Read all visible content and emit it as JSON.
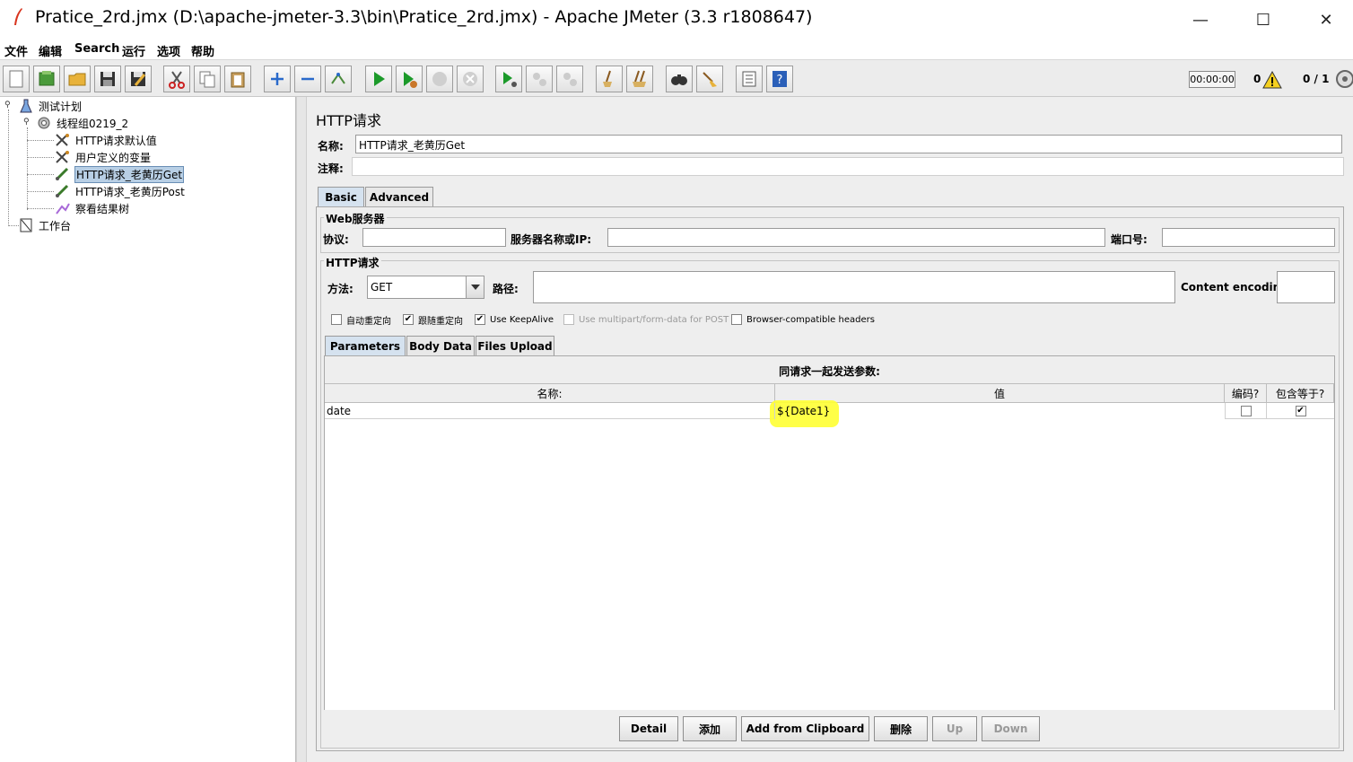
{
  "window": {
    "title": "Pratice_2rd.jmx (D:\\apache-jmeter-3.3\\bin\\Pratice_2rd.jmx) - Apache JMeter (3.3 r1808647)",
    "minimize": "—",
    "maximize": "☐",
    "close": "✕"
  },
  "menu": [
    "文件",
    "编辑",
    "Search",
    "运行",
    "选项",
    "帮助"
  ],
  "toolbar": {
    "timer": "00:00:00",
    "error_count": "0",
    "threads": "0 / 1",
    "icons": [
      "new-icon",
      "templates-icon",
      "open-icon",
      "save-icon",
      "save-as-icon",
      "cut-icon",
      "copy-icon",
      "paste-icon",
      "expand-icon",
      "collapse-icon",
      "toggle-icon",
      "start-icon",
      "start-no-pause-icon",
      "stop-icon",
      "shutdown-icon",
      "remote-start-icon",
      "remote-stop-icon",
      "remote-exit-icon",
      "clear-icon",
      "clear-all-icon",
      "search-icon",
      "reset-search-icon",
      "function-helper-icon",
      "help-icon"
    ]
  },
  "tree": {
    "items": [
      {
        "label": "测试计划",
        "icon": "test-plan-icon"
      },
      {
        "label": "线程组0219_2",
        "icon": "thread-group-icon"
      },
      {
        "label": "HTTP请求默认值",
        "icon": "config-element-icon"
      },
      {
        "label": "用户定义的变量",
        "icon": "config-element-icon"
      },
      {
        "label": "HTTP请求_老黄历Get",
        "icon": "sampler-icon"
      },
      {
        "label": "HTTP请求_老黄历Post",
        "icon": "sampler-icon"
      },
      {
        "label": "察看结果树",
        "icon": "listener-icon"
      },
      {
        "label": "工作台",
        "icon": "workbench-icon"
      }
    ]
  },
  "panel": {
    "title": "HTTP请求",
    "name_label": "名称:",
    "name_value": "HTTP请求_老黄历Get",
    "comment_label": "注释:",
    "comment_value": "",
    "tabs": [
      "Basic",
      "Advanced"
    ],
    "web_server": {
      "group_title": "Web服务器",
      "protocol_label": "协议:",
      "protocol_value": "",
      "server_label": "服务器名称或IP:",
      "server_value": "",
      "port_label": "端口号:",
      "port_value": ""
    },
    "http_request": {
      "group_title": "HTTP请求",
      "method_label": "方法:",
      "method_value": "GET",
      "path_label": "路径:",
      "path_value": "",
      "encoding_label": "Content encoding:",
      "encoding_value": ""
    },
    "checkboxes": [
      {
        "label": "自动重定向",
        "checked": false
      },
      {
        "label": "跟随重定向",
        "checked": true
      },
      {
        "label": "Use KeepAlive",
        "checked": true
      },
      {
        "label": "Use multipart/form-data for POST",
        "checked": false
      },
      {
        "label": "Browser-compatible headers",
        "checked": false
      }
    ],
    "sub_tabs": [
      "Parameters",
      "Body Data",
      "Files Upload"
    ],
    "params_title": "同请求一起发送参数:",
    "table": {
      "headers": [
        "名称:",
        "值",
        "编码?",
        "包含等于?"
      ],
      "rows": [
        {
          "name": "date",
          "value": "${Date1}",
          "encode": false,
          "include_equals": true
        }
      ]
    },
    "buttons": [
      {
        "label": "Detail",
        "enabled": true
      },
      {
        "label": "添加",
        "enabled": true
      },
      {
        "label": "Add from Clipboard",
        "enabled": true
      },
      {
        "label": "删除",
        "enabled": true
      },
      {
        "label": "Up",
        "enabled": false
      },
      {
        "label": "Down",
        "enabled": false
      }
    ]
  }
}
